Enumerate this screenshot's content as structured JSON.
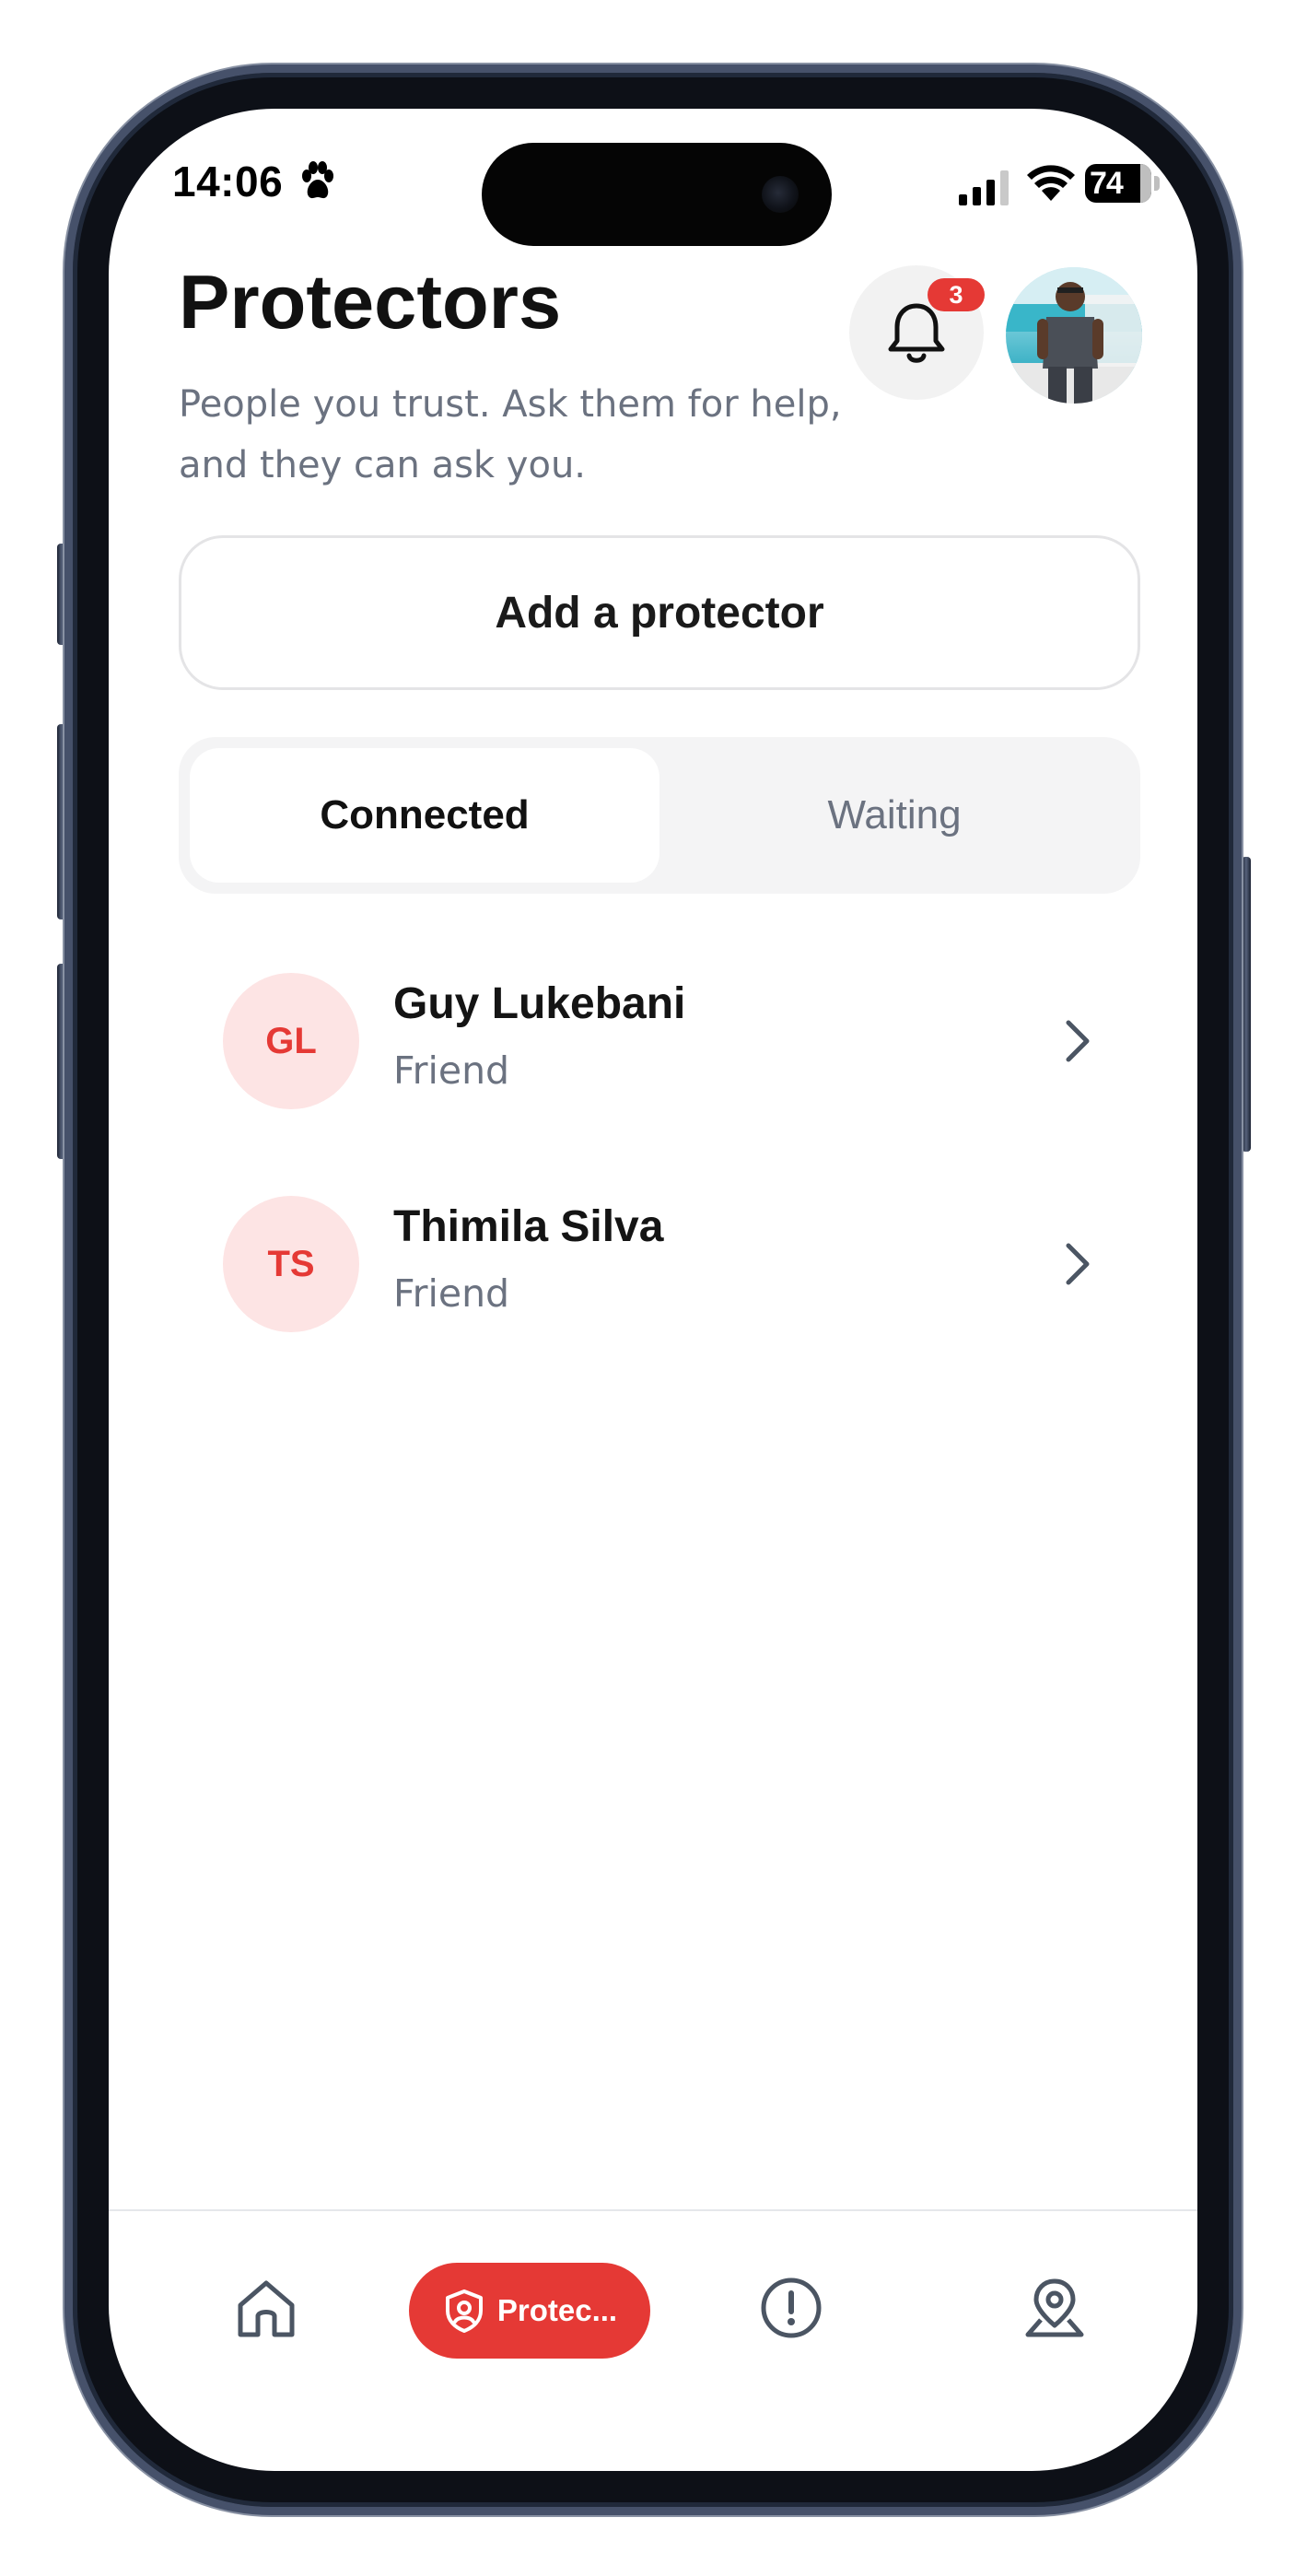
{
  "status_bar": {
    "time": "14:06",
    "battery": "74",
    "icons": [
      "paw-icon",
      "signal-icon",
      "wifi-icon",
      "battery-icon"
    ]
  },
  "header": {
    "title": "Protectors",
    "subtitle": "People you trust. Ask them for help, and they can ask you.",
    "notification_count": "3"
  },
  "actions": {
    "add_label": "Add a protector"
  },
  "tabs": {
    "connected": "Connected",
    "waiting": "Waiting",
    "selected": "Connected"
  },
  "protectors": [
    {
      "initials": "GL",
      "name": "Guy Lukebani",
      "relation": "Friend"
    },
    {
      "initials": "TS",
      "name": "Thimila Silva",
      "relation": "Friend"
    }
  ],
  "bottom_nav": {
    "items": [
      {
        "icon": "home-icon"
      },
      {
        "icon": "shield-user-icon",
        "label": "Protec..."
      },
      {
        "icon": "alert-circle-icon"
      },
      {
        "icon": "map-pin-icon"
      }
    ],
    "active_index": 1
  },
  "colors": {
    "accent": "#e53935",
    "accent_soft": "#fde4e4",
    "muted_text": "#6b7280",
    "segment_bg": "#f4f4f5"
  }
}
